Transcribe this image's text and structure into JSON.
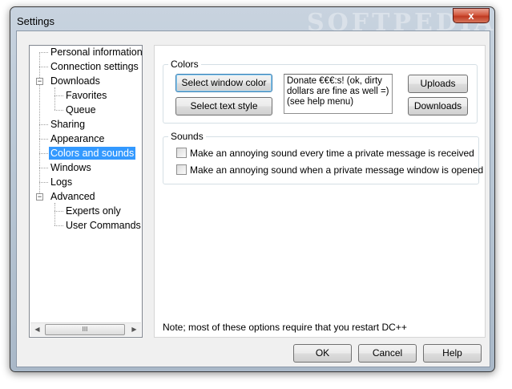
{
  "window": {
    "title": "Settings",
    "watermark": "SOFTPEDIA",
    "close_symbol": "x"
  },
  "tree": {
    "items": [
      {
        "label": "Personal information"
      },
      {
        "label": "Connection settings"
      },
      {
        "label": "Downloads",
        "expander": "−"
      },
      {
        "label": "Favorites"
      },
      {
        "label": "Queue"
      },
      {
        "label": "Sharing"
      },
      {
        "label": "Appearance"
      },
      {
        "label": "Colors and sounds",
        "selected": true
      },
      {
        "label": "Windows"
      },
      {
        "label": "Logs"
      },
      {
        "label": "Advanced",
        "expander": "−"
      },
      {
        "label": "Experts only"
      },
      {
        "label": "User Commands"
      }
    ],
    "scroll_left": "◀",
    "scroll_right": "▶",
    "scroll_grip": "III"
  },
  "colors_group": {
    "label": "Colors",
    "select_window_color": "Select window color",
    "select_text_style": "Select text style",
    "sample_text": "Donate €€€:s! (ok, dirty\ndollars are fine as well =)\n(see help menu)",
    "uploads": "Uploads",
    "downloads": "Downloads"
  },
  "sounds_group": {
    "label": "Sounds",
    "checkboxes": [
      {
        "label": "Make an annoying sound every time a private message is received",
        "checked": false
      },
      {
        "label": "Make an annoying sound when a private message window is opened",
        "checked": false
      }
    ]
  },
  "note": "Note; most of these options require that you restart DC++",
  "buttons": {
    "ok": "OK",
    "cancel": "Cancel",
    "help": "Help"
  }
}
